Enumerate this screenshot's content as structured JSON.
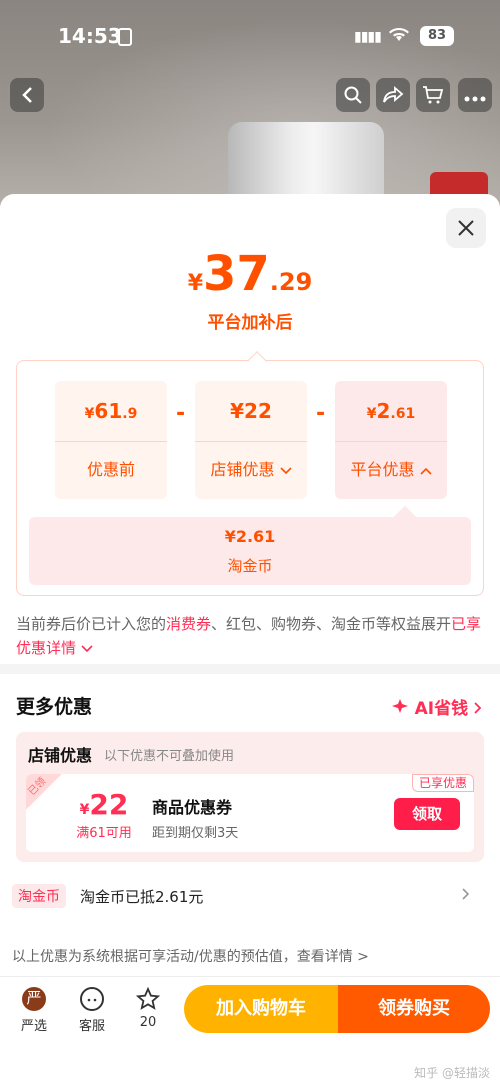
{
  "status": {
    "time": "14:53",
    "battery": "83"
  },
  "price": {
    "yen": "¥",
    "int": "37",
    "dec": ".29",
    "subtitle": "平台加补后"
  },
  "calc": {
    "before": {
      "yen": "¥",
      "int": "61",
      "dec": ".9",
      "label": "优惠前"
    },
    "store": {
      "value": "¥22",
      "label": "店铺优惠"
    },
    "platform": {
      "yen": "¥",
      "int": "2",
      "dec": ".61",
      "label": "平台优惠"
    },
    "minus": "-",
    "coin": {
      "value": "¥2.61",
      "label": "淘金币"
    }
  },
  "note": {
    "part1": "当前券后价已计入您的",
    "hl1": "消费券",
    "part2": "、红包、购物券、淘金币等权益展开",
    "hl2": "已享优惠详情"
  },
  "more": {
    "title": "更多优惠",
    "ai": "AI省钱"
  },
  "store_section": {
    "title": "店铺优惠",
    "desc": "以下优惠不可叠加使用",
    "coupon": {
      "ribbon": "已领",
      "yen": "¥",
      "amount": "22",
      "condition": "满61可用",
      "name": "商品优惠券",
      "expiry": "距到期仅剩3天",
      "tag": "已享优惠",
      "button": "领取"
    }
  },
  "taojinbi": {
    "tag": "淘金币",
    "text": "淘金币已抵2.61元"
  },
  "disclaimer": "以上优惠为系统根据可享活动/优惠的预估值，查看详情 >",
  "bottom": {
    "yanxuan": "严选",
    "kefu": "客服",
    "fav_count": "20",
    "cart": "加入购物车",
    "buy": "领券购买"
  },
  "watermark": "知乎 @轻描淡"
}
